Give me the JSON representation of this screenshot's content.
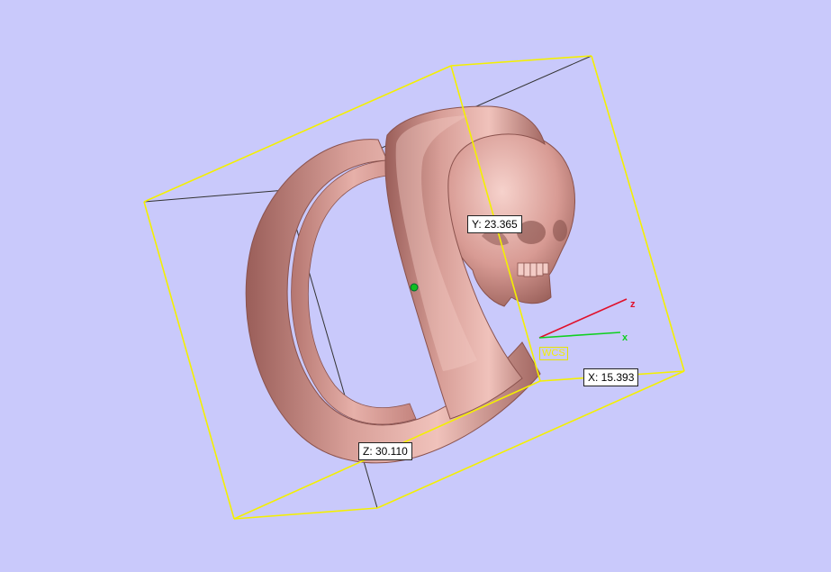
{
  "viewport": {
    "background_color": "#c9c9fb",
    "bbox_color": "#f4f000",
    "model_color": "#d4918a"
  },
  "dimensions": {
    "x_label": "X: 15.393",
    "y_label": "Y: 23.365",
    "z_label": "Z: 30.110"
  },
  "triad": {
    "label": "WCS",
    "z_axis": {
      "letter": "z",
      "color": "#e0102a"
    },
    "x_axis": {
      "letter": "x",
      "color": "#10d020"
    }
  },
  "model": {
    "name_icon": "skull-ring-model",
    "pivot_color": "#10c020"
  }
}
